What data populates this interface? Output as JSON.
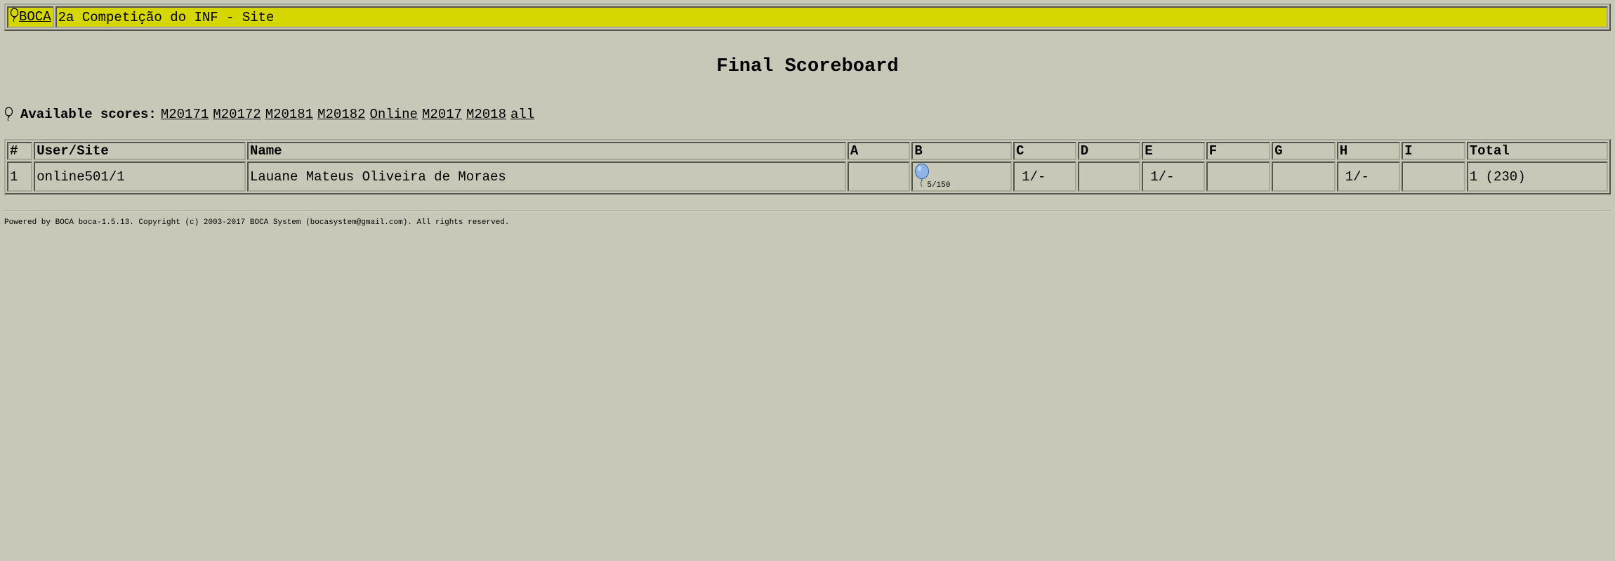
{
  "header": {
    "brand_label": "BOCA",
    "site_title": "2a Competição do INF - Site"
  },
  "page_title": "Final Scoreboard",
  "scores": {
    "label": "Available scores:",
    "links": [
      "M20171",
      "M20172",
      "M20181",
      "M20182",
      "Online",
      "M2017",
      "M2018",
      "all"
    ]
  },
  "table": {
    "headers": [
      "#",
      "User/Site",
      "Name",
      "A",
      "B",
      "C",
      "D",
      "E",
      "F",
      "G",
      "H",
      "I",
      "Total"
    ],
    "rows": [
      {
        "rank": "1",
        "user_site": "online501/1",
        "name": "Lauane Mateus Oliveira de Moraes",
        "problems": {
          "A": "",
          "B": "5/150",
          "C": "1/-",
          "D": "",
          "E": "1/-",
          "F": "",
          "G": "",
          "H": "1/-",
          "I": ""
        },
        "balloon_color": "#8fb4e8",
        "total": "1 (230)"
      }
    ]
  },
  "footer": {
    "text": "Powered by BOCA boca-1.5.13. Copyright (c) 2003-2017 BOCA System (bocasystem@gmail.com). All rights reserved."
  }
}
